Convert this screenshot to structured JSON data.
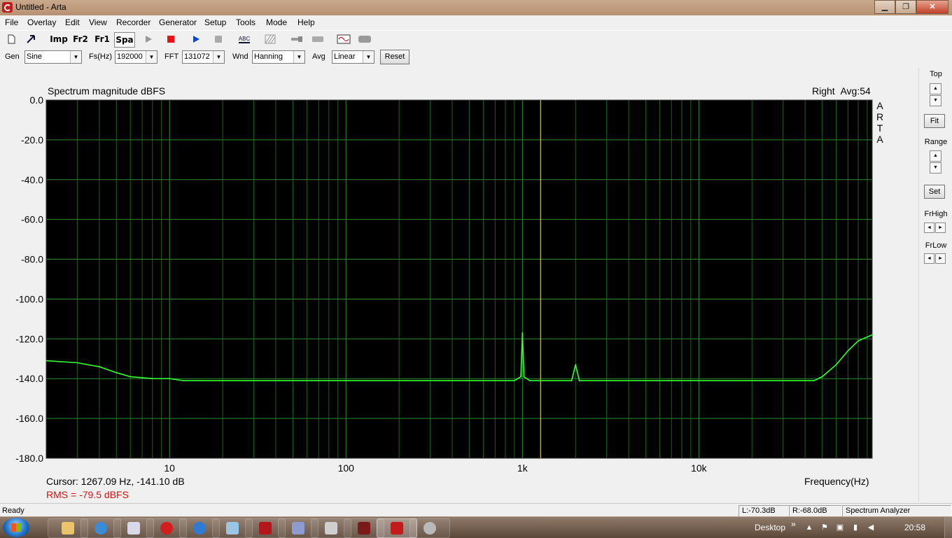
{
  "window": {
    "title": "Untitled - Arta",
    "min": "▁",
    "max": "❐",
    "close": "✕"
  },
  "menu": [
    "File",
    "Overlay",
    "Edit",
    "View",
    "Recorder",
    "Generator",
    "Setup",
    "Tools",
    "Mode",
    "Help"
  ],
  "toolbar": {
    "new_icon": "new-file-icon",
    "open_icon": "open-icon",
    "imp_label": "Imp",
    "fr2_label": "Fr2",
    "fr1_label": "Fr1",
    "spa_label": "Spa",
    "play_icon": "play-icon",
    "record_icon": "record-icon",
    "run_icon": "run-icon",
    "stop_icon": "stop-icon",
    "abc_label": "ABC"
  },
  "controls": {
    "gen_label": "Gen",
    "gen_value": "Sine",
    "fs_label": "Fs(Hz)",
    "fs_value": "192000",
    "fft_label": "FFT",
    "fft_value": "131072",
    "wnd_label": "Wnd",
    "wnd_value": "Hanning",
    "avg_label": "Avg",
    "avg_value": "Linear",
    "reset_label": "Reset"
  },
  "graph": {
    "title": "Spectrum magnitude dBFS",
    "channel": "Right",
    "avg": "Avg:54",
    "watermark": [
      "A",
      "R",
      "T",
      "A"
    ],
    "cursor_text": "Cursor: 1267.09 Hz, -141.10 dB",
    "rms_text": "RMS =  -79.5 dBFS",
    "xlabel": "Frequency(Hz)"
  },
  "chart_data": {
    "type": "line",
    "title": "Spectrum magnitude dBFS",
    "xlabel": "Frequency(Hz)",
    "ylabel": "",
    "x_scale": "log",
    "xlim": [
      2,
      96000
    ],
    "ylim": [
      -180,
      0
    ],
    "y_ticks": [
      "0.0",
      "-20.0",
      "-40.0",
      "-60.0",
      "-80.0",
      "-100.0",
      "-120.0",
      "-140.0",
      "-160.0",
      "-180.0"
    ],
    "x_ticks": [
      {
        "v": 10,
        "label": "10"
      },
      {
        "v": 100,
        "label": "100"
      },
      {
        "v": 1000,
        "label": "1k"
      },
      {
        "v": 10000,
        "label": "10k"
      }
    ],
    "grid": true,
    "cursor_x": 1267.09,
    "series": [
      {
        "color": "#33ff33",
        "x": [
          2,
          3,
          4,
          5,
          6,
          7,
          8,
          10,
          12,
          15,
          20,
          30,
          50,
          100,
          200,
          500,
          900,
          980,
          1000,
          1020,
          1100,
          1267,
          1900,
          2000,
          2100,
          5000,
          10000,
          20000,
          40000,
          45000,
          50000,
          60000,
          70000,
          80000,
          96000
        ],
        "values": [
          -131,
          -132,
          -134,
          -137,
          -139,
          -139.5,
          -140,
          -140,
          -141,
          -141,
          -141,
          -141,
          -141,
          -141,
          -141,
          -141,
          -141,
          -139,
          -117,
          -139,
          -141,
          -141,
          -141,
          -133,
          -141,
          -141,
          -141,
          -141,
          -141,
          -141,
          -139,
          -133,
          -126,
          -121,
          -118
        ]
      }
    ]
  },
  "side": {
    "top_label": "Top",
    "fit_label": "Fit",
    "range_label": "Range",
    "set_label": "Set",
    "frhigh_label": "FrHigh",
    "frlow_label": "FrLow",
    "up": "▲",
    "down": "▼",
    "left": "◄",
    "right": "►"
  },
  "status": {
    "ready": "Ready",
    "left_level": "L:-70.3dB",
    "right_level": "R:-68.0dB",
    "mode": "Spectrum Analyzer"
  },
  "taskbar": {
    "desktop": "Desktop",
    "chevron": "»",
    "time": "20:58",
    "apps": [
      "explorer",
      "ie",
      "calculator",
      "opera",
      "chrome",
      "window",
      "acrobat",
      "app-a",
      "app-b",
      "app-c",
      "arta",
      "app-d"
    ]
  }
}
